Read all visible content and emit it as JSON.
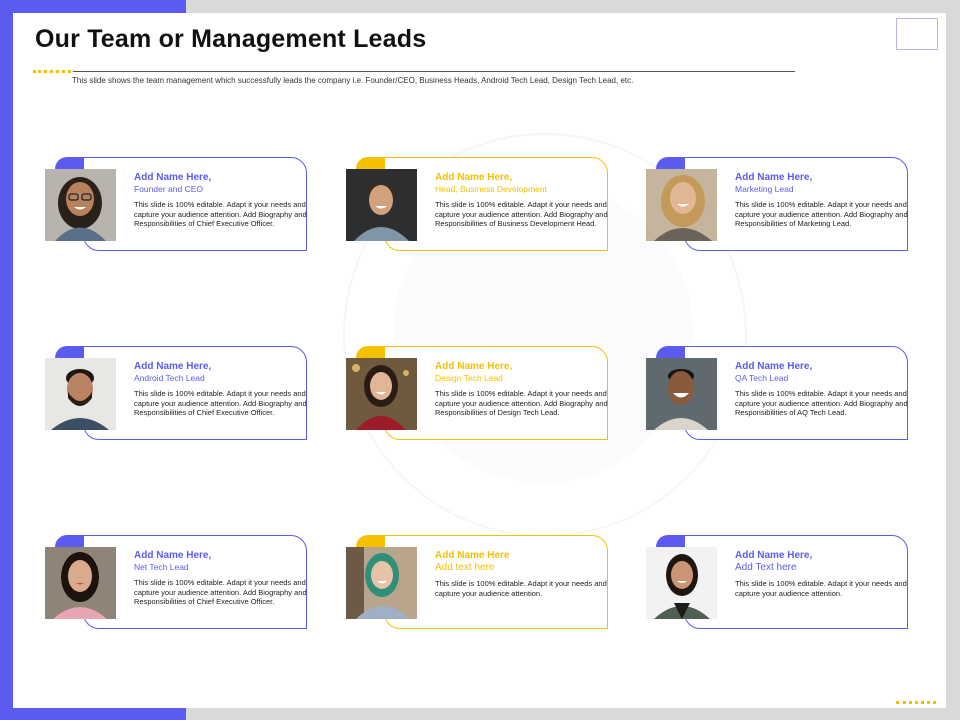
{
  "title": "Our Team or Management Leads",
  "subtitle": "This slide shows the team management which successfully leads the company i.e. Founder/CEO, Business Heads, Android Tech Lead, Design Tech Lead, etc.",
  "colors": {
    "blue": "#5b5bf0",
    "yellow": "#f5c000",
    "gray": "#d9d9d9"
  },
  "cards": [
    {
      "name": "Add Name Here,",
      "role": "Founder and CEO",
      "desc": "This slide is 100% editable. Adapt it your needs and capture your audience attention. Add Biography and Responsibilities of Chief Executive Officer.",
      "photo": "woman-glasses-photo"
    },
    {
      "name": "Add Name Here,",
      "role": "Head, Business Development",
      "desc": "This slide is 100% editable. Adapt it your needs and capture your audience attention. Add Biography and Responsibilities of Business Development Head.",
      "photo": "man-smiling-photo"
    },
    {
      "name": "Add Name Here,",
      "role": "Marketing Lead",
      "desc": "This slide is 100% editable. Adapt it your needs and capture your audience attention. Add Biography and Responsibilities of Marketing Lead.",
      "photo": "blonde-woman-photo"
    },
    {
      "name": "Add Name Here,",
      "role": "Android Tech Lead",
      "desc": "This slide is 100% editable. Adapt it your needs and capture your audience attention. Add Biography and Responsibilities of Chief Executive Officer.",
      "photo": "bearded-man-photo"
    },
    {
      "name": "Add Name Here,",
      "role": "Design Tech Lead",
      "desc": "This slide is 100% editable. Adapt it your needs and capture your audience attention. Add Biography and Responsibilities of Design Tech Lead.",
      "photo": "woman-red-sweater-photo"
    },
    {
      "name": "Add Name Here,",
      "role": "QA Tech Lead",
      "desc": "This slide is 100% editable. Adapt it your needs and capture your audience attention. Add Biography and Responsibilities of AQ Tech Lead.",
      "photo": "man-grin-photo"
    },
    {
      "name": "Add Name Here,",
      "role": "Net Tech Lead",
      "desc": "This slide is 100% editable. Adapt it your needs and capture your audience attention. Add Biography and Responsibilities of Chief Executive Officer.",
      "photo": "woman-pink-photo"
    },
    {
      "name": "Add Name Here",
      "role": "Add text here",
      "desc": "This slide is 100% editable. Adapt it your needs and capture your audience attention.",
      "photo": "woman-green-hair-photo"
    },
    {
      "name": "Add Name Here,",
      "role": "Add Text here",
      "desc": "This slide is 100% editable. Adapt it your needs and capture your audience attention.",
      "photo": "woman-jacket-photo"
    }
  ]
}
